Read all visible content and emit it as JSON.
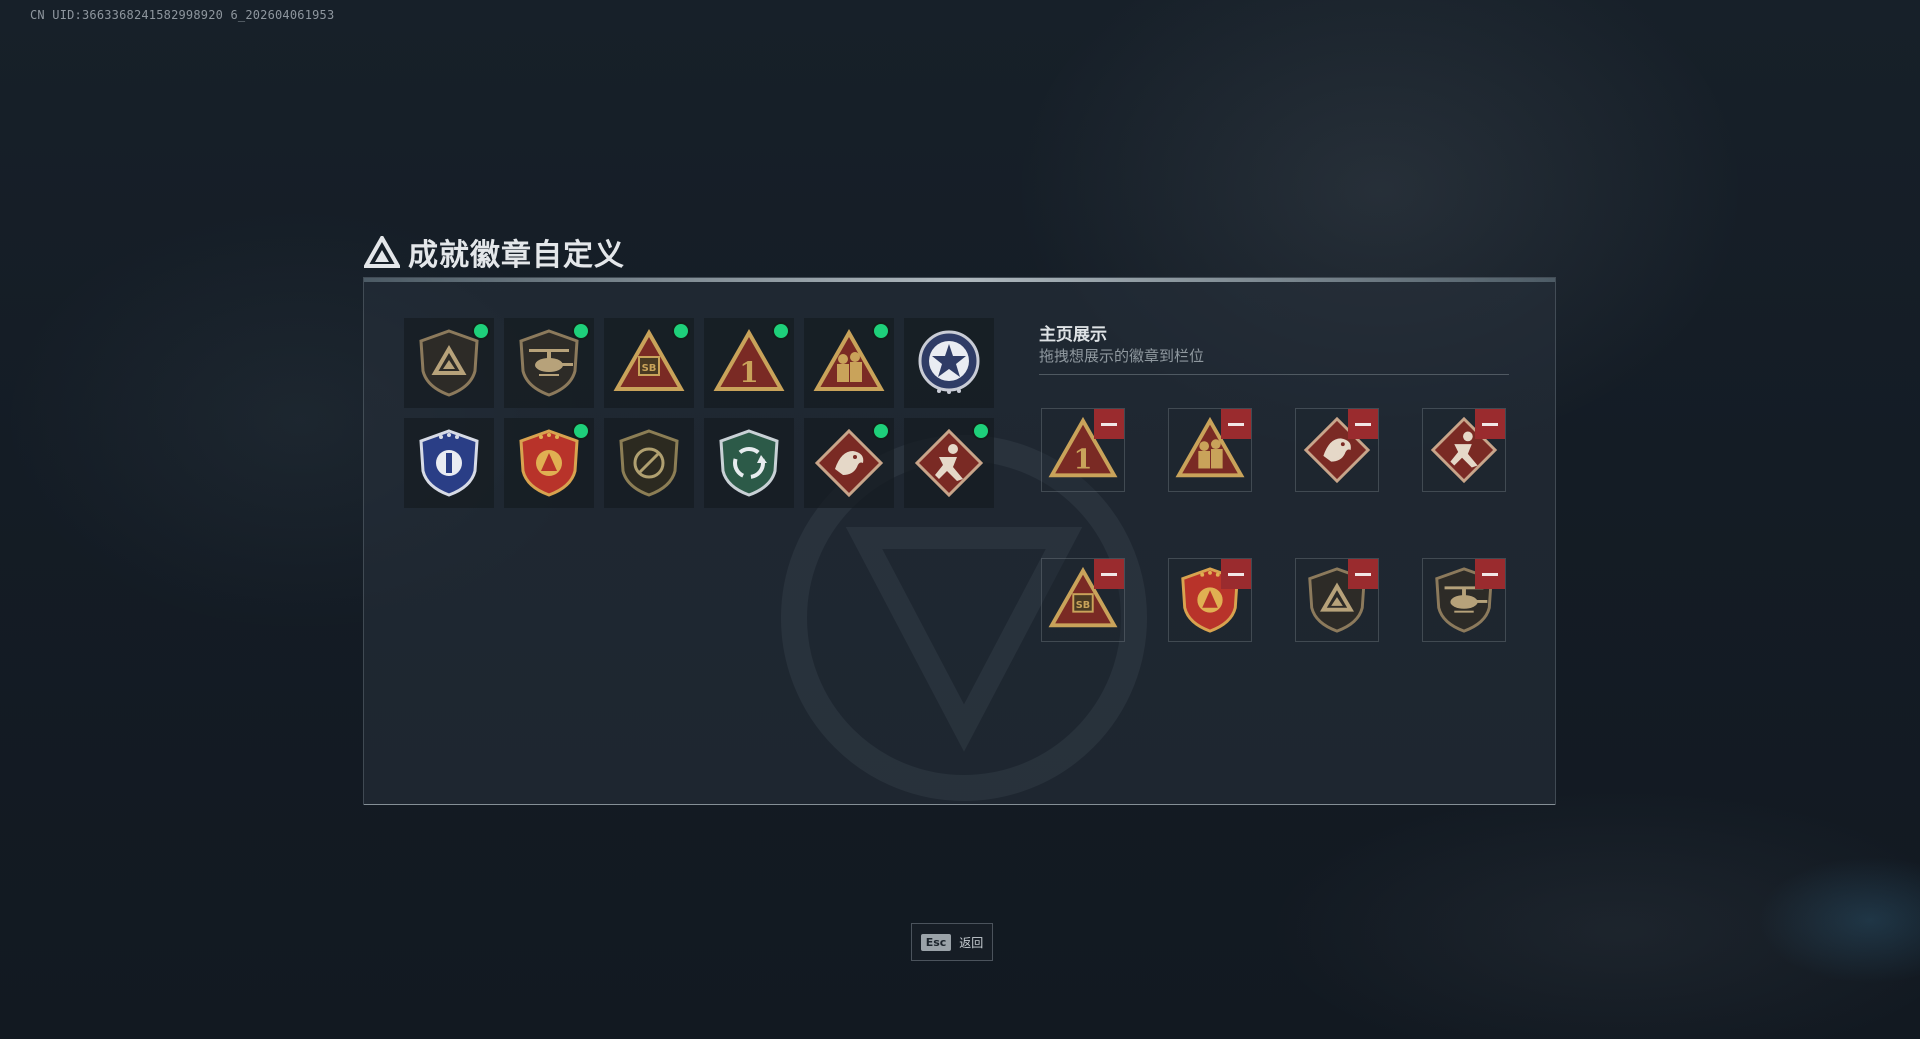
{
  "watermark": "CN UID:3663368241582998920 6_202604061953",
  "title": "成就徽章自定义",
  "showcase": {
    "title": "主页展示",
    "subtitle": "拖拽想展示的徽章到栏位"
  },
  "badges": [
    {
      "icon": "shield-triangle-icon",
      "equipped": true
    },
    {
      "icon": "helicopter-icon",
      "equipped": true
    },
    {
      "icon": "sb-triangle-icon",
      "equipped": true
    },
    {
      "icon": "number-one-triangle-icon",
      "equipped": true
    },
    {
      "icon": "soldiers-triangle-icon",
      "equipped": true
    },
    {
      "icon": "star-seal-icon",
      "equipped": false
    },
    {
      "icon": "blue-police-badge-icon",
      "equipped": false
    },
    {
      "icon": "red-star-shield-icon",
      "equipped": true
    },
    {
      "icon": "no-weapon-shield-icon",
      "equipped": false
    },
    {
      "icon": "green-cycle-shield-icon",
      "equipped": false
    },
    {
      "icon": "dragon-diamond-icon",
      "equipped": true
    },
    {
      "icon": "runner-diamond-icon",
      "equipped": true
    }
  ],
  "slots": [
    {
      "icon": "number-one-triangle-icon"
    },
    {
      "icon": "soldiers-triangle-icon"
    },
    {
      "icon": "dragon-diamond-icon"
    },
    {
      "icon": "runner-diamond-icon"
    },
    {
      "icon": "sb-triangle-icon"
    },
    {
      "icon": "red-star-shield-icon"
    },
    {
      "icon": "shield-triangle-icon"
    },
    {
      "icon": "helicopter-icon"
    }
  ],
  "esc": {
    "key": "Esc",
    "label": "返回"
  },
  "colors": {
    "equipped_dot": "#1ed07a",
    "remove_button": "#9a2b2e",
    "gold": "#c9a35a",
    "dark_red": "#7a2a24"
  }
}
